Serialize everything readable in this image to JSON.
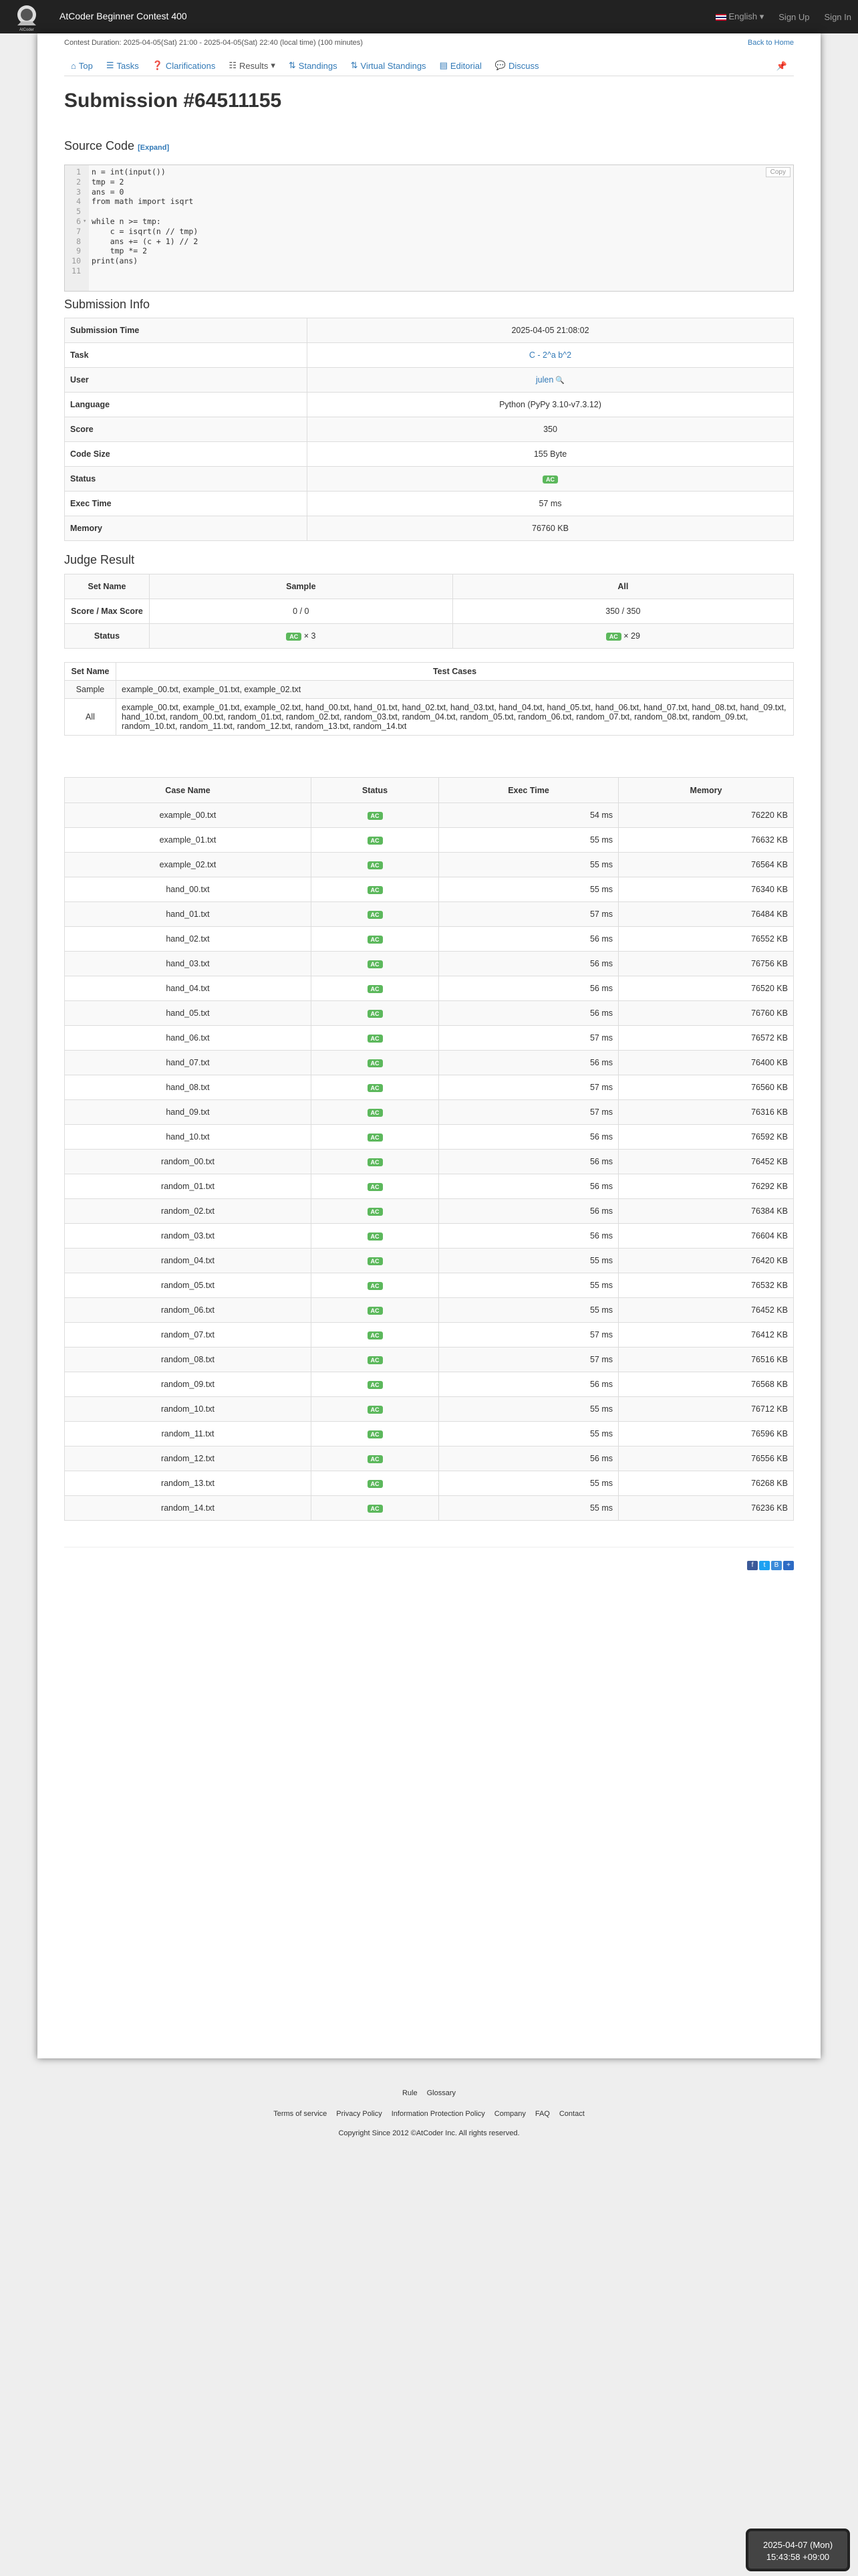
{
  "navbar": {
    "brand": "AtCoder Beginner Contest 400",
    "logo_text": "AtCoder",
    "language": "English",
    "sign_up": "Sign Up",
    "sign_in": "Sign In"
  },
  "contest": {
    "duration": "Contest Duration: 2025-04-05(Sat) 21:00 - 2025-04-05(Sat) 22:40 (local time) (100 minutes)",
    "back_home": "Back to Home"
  },
  "tabs": [
    "Top",
    "Tasks",
    "Clarifications",
    "Results",
    "Standings",
    "Virtual Standings",
    "Editorial",
    "Discuss"
  ],
  "page_title": "Submission #64511155",
  "source_code": {
    "heading": "Source Code",
    "expand": "[Expand]",
    "copy": "Copy",
    "lines": [
      "n = int(input())",
      "tmp = 2",
      "ans = 0",
      "from math import isqrt",
      "",
      "while n >= tmp:",
      "    c = isqrt(n // tmp)",
      "    ans += (c + 1) // 2",
      "    tmp *= 2",
      "print(ans)",
      ""
    ]
  },
  "submission_info": {
    "heading": "Submission Info",
    "rows": [
      {
        "label": "Submission Time",
        "value": "2025-04-05 21:08:02"
      },
      {
        "label": "Task",
        "value": "C - 2^a b^2"
      },
      {
        "label": "User",
        "value": "julen"
      },
      {
        "label": "Language",
        "value": "Python (PyPy 3.10-v7.3.12)"
      },
      {
        "label": "Score",
        "value": "350"
      },
      {
        "label": "Code Size",
        "value": "155 Byte"
      },
      {
        "label": "Status",
        "value": "AC"
      },
      {
        "label": "Exec Time",
        "value": "57 ms"
      },
      {
        "label": "Memory",
        "value": "76760 KB"
      }
    ]
  },
  "judge_result": {
    "heading": "Judge Result",
    "headers": [
      "Set Name",
      "Sample",
      "All"
    ],
    "score_label": "Score / Max Score",
    "score_sample": "0 / 0",
    "score_all": "350 / 350",
    "status_label": "Status",
    "status_sample": "× 3",
    "status_all": "× 29"
  },
  "sets": {
    "headers": [
      "Set Name",
      "Test Cases"
    ],
    "rows": [
      {
        "name": "Sample",
        "cases": "example_00.txt, example_01.txt, example_02.txt"
      },
      {
        "name": "All",
        "cases": "example_00.txt, example_01.txt, example_02.txt, hand_00.txt, hand_01.txt, hand_02.txt, hand_03.txt, hand_04.txt, hand_05.txt, hand_06.txt, hand_07.txt, hand_08.txt, hand_09.txt, hand_10.txt, random_00.txt, random_01.txt, random_02.txt, random_03.txt, random_04.txt, random_05.txt, random_06.txt, random_07.txt, random_08.txt, random_09.txt, random_10.txt, random_11.txt, random_12.txt, random_13.txt, random_14.txt"
      }
    ]
  },
  "cases": {
    "headers": [
      "Case Name",
      "Status",
      "Exec Time",
      "Memory"
    ],
    "rows": [
      [
        "example_00.txt",
        "AC",
        "54 ms",
        "76220 KB"
      ],
      [
        "example_01.txt",
        "AC",
        "55 ms",
        "76632 KB"
      ],
      [
        "example_02.txt",
        "AC",
        "55 ms",
        "76564 KB"
      ],
      [
        "hand_00.txt",
        "AC",
        "55 ms",
        "76340 KB"
      ],
      [
        "hand_01.txt",
        "AC",
        "57 ms",
        "76484 KB"
      ],
      [
        "hand_02.txt",
        "AC",
        "56 ms",
        "76552 KB"
      ],
      [
        "hand_03.txt",
        "AC",
        "56 ms",
        "76756 KB"
      ],
      [
        "hand_04.txt",
        "AC",
        "56 ms",
        "76520 KB"
      ],
      [
        "hand_05.txt",
        "AC",
        "56 ms",
        "76760 KB"
      ],
      [
        "hand_06.txt",
        "AC",
        "57 ms",
        "76572 KB"
      ],
      [
        "hand_07.txt",
        "AC",
        "56 ms",
        "76400 KB"
      ],
      [
        "hand_08.txt",
        "AC",
        "57 ms",
        "76560 KB"
      ],
      [
        "hand_09.txt",
        "AC",
        "57 ms",
        "76316 KB"
      ],
      [
        "hand_10.txt",
        "AC",
        "56 ms",
        "76592 KB"
      ],
      [
        "random_00.txt",
        "AC",
        "56 ms",
        "76452 KB"
      ],
      [
        "random_01.txt",
        "AC",
        "56 ms",
        "76292 KB"
      ],
      [
        "random_02.txt",
        "AC",
        "56 ms",
        "76384 KB"
      ],
      [
        "random_03.txt",
        "AC",
        "56 ms",
        "76604 KB"
      ],
      [
        "random_04.txt",
        "AC",
        "55 ms",
        "76420 KB"
      ],
      [
        "random_05.txt",
        "AC",
        "55 ms",
        "76532 KB"
      ],
      [
        "random_06.txt",
        "AC",
        "55 ms",
        "76452 KB"
      ],
      [
        "random_07.txt",
        "AC",
        "57 ms",
        "76412 KB"
      ],
      [
        "random_08.txt",
        "AC",
        "57 ms",
        "76516 KB"
      ],
      [
        "random_09.txt",
        "AC",
        "56 ms",
        "76568 KB"
      ],
      [
        "random_10.txt",
        "AC",
        "55 ms",
        "76712 KB"
      ],
      [
        "random_11.txt",
        "AC",
        "55 ms",
        "76596 KB"
      ],
      [
        "random_12.txt",
        "AC",
        "56 ms",
        "76556 KB"
      ],
      [
        "random_13.txt",
        "AC",
        "55 ms",
        "76268 KB"
      ],
      [
        "random_14.txt",
        "AC",
        "55 ms",
        "76236 KB"
      ]
    ]
  },
  "footer": {
    "row1": [
      "Rule",
      "Glossary"
    ],
    "row2": [
      "Terms of service",
      "Privacy Policy",
      "Information Protection Policy",
      "Company",
      "FAQ",
      "Contact"
    ],
    "copyright": "Copyright Since 2012 ©AtCoder Inc. All rights reserved."
  },
  "clock": {
    "date": "2025-04-07 (Mon)",
    "time": "15:43:58 +09:00"
  },
  "colors": {
    "accent": "#337ab7",
    "ac_green": "#5cb85c",
    "navbar": "#222222"
  }
}
